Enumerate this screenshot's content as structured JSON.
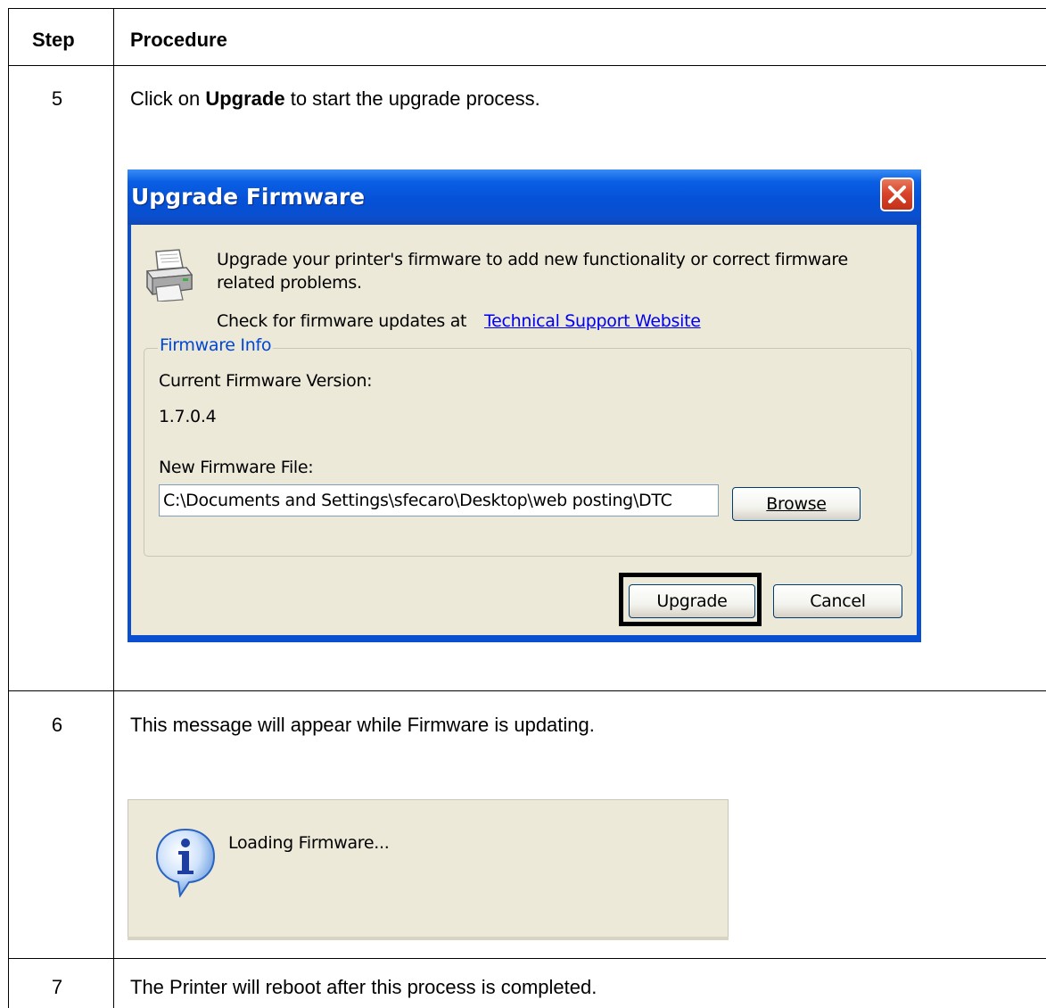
{
  "table": {
    "headers": {
      "step": "Step",
      "procedure": "Procedure"
    },
    "rows": [
      {
        "step": "5",
        "text_before": "Click on ",
        "text_bold": "Upgrade",
        "text_after": " to start the upgrade process."
      },
      {
        "step": "6",
        "text": "This message will appear while Firmware is updating."
      },
      {
        "step": "7",
        "text": "The Printer will reboot after this process is completed."
      }
    ]
  },
  "dialog": {
    "title": "Upgrade Firmware",
    "description_line1": "Upgrade your printer's firmware to add new functionality or correct firmware",
    "description_line2": "related problems.",
    "check_text": "Check for firmware updates at",
    "link_text": "Technical Support Website",
    "group_label": "Firmware Info",
    "current_version_label": "Current Firmware Version:",
    "current_version_value": "1.7.0.4",
    "new_file_label": "New Firmware File:",
    "new_file_value": "C:\\Documents and Settings\\sfecaro\\Desktop\\web posting\\DTC",
    "browse_label": "Browse",
    "upgrade_label": "Upgrade",
    "cancel_label": "Cancel",
    "colors": {
      "titlebar": "#0551d8",
      "face": "#ece9d8",
      "link": "#0000ee",
      "group_label": "#0046d5",
      "close": "#d9452b"
    }
  },
  "loading_message": {
    "text": "Loading Firmware...",
    "icon": "info-icon"
  }
}
